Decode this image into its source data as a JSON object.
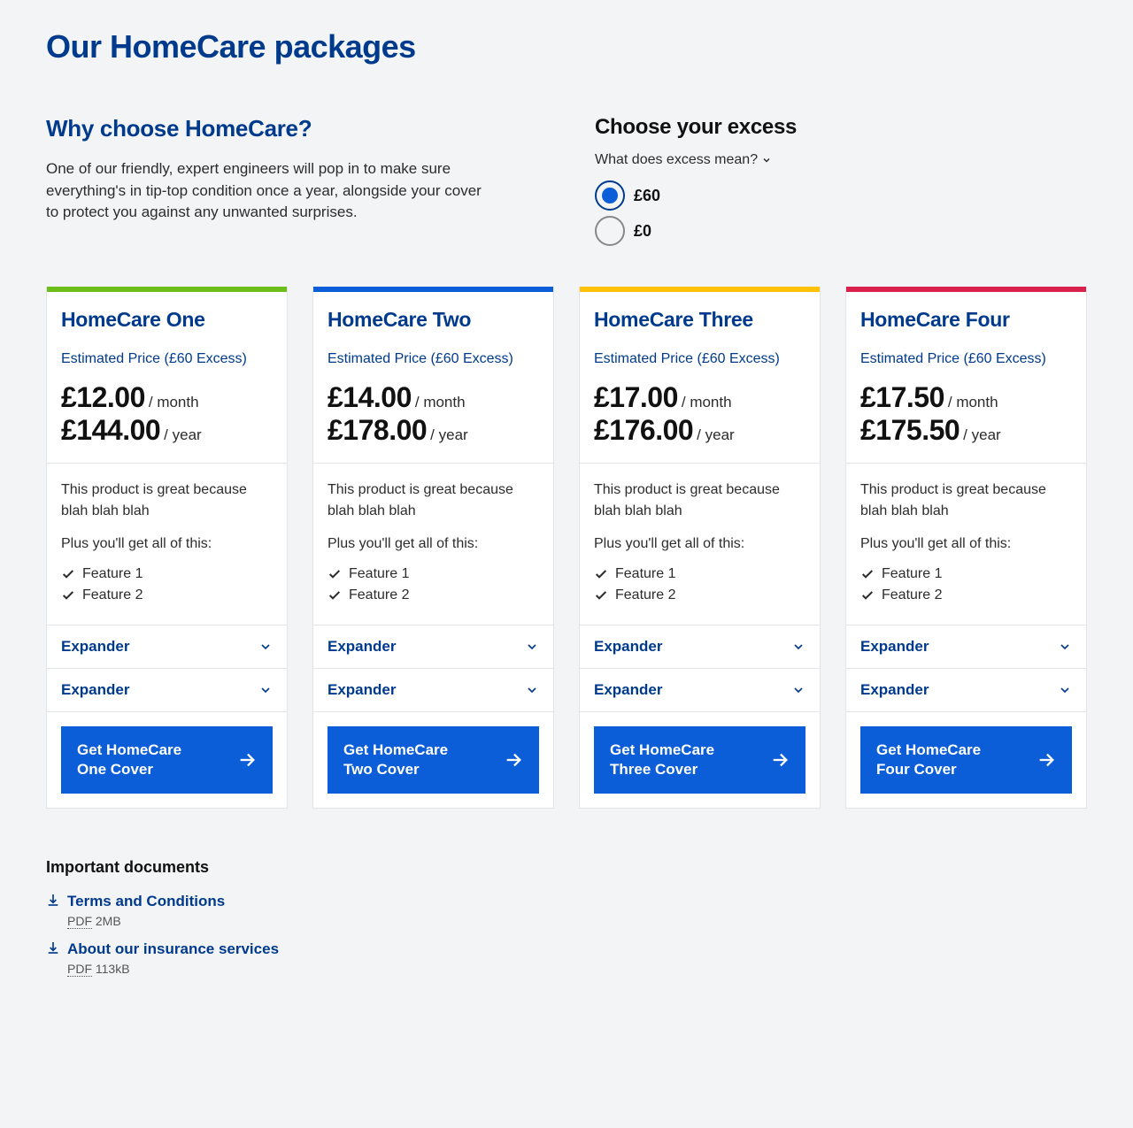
{
  "page_title": "Our HomeCare packages",
  "why": {
    "heading": "Why choose HomeCare?",
    "body": "One of our friendly, expert engineers will pop in to make sure everything's in tip-top condition once a year, alongside your cover to protect you against any unwanted surprises."
  },
  "excess": {
    "heading": "Choose your excess",
    "help_label": "What does excess mean?",
    "options": [
      {
        "label": "£60",
        "selected": true
      },
      {
        "label": "£0",
        "selected": false
      }
    ]
  },
  "est_label": "Estimated Price (£60 Excess)",
  "per_month": " / month",
  "per_year": " / year",
  "body_text": "This product is great because blah blah blah",
  "plus_text": "Plus you'll get all of this:",
  "feature1": "Feature 1",
  "feature2": "Feature 2",
  "expander_label": "Expander",
  "packages": [
    {
      "name": "HomeCare One",
      "accent": "accent-green",
      "monthly": "£12.00",
      "yearly": "£144.00",
      "cta": "Get HomeCare One Cover"
    },
    {
      "name": "HomeCare Two",
      "accent": "accent-blue",
      "monthly": "£14.00",
      "yearly": "£178.00",
      "cta": "Get HomeCare Two Cover"
    },
    {
      "name": "HomeCare Three",
      "accent": "accent-yellow",
      "monthly": "£17.00",
      "yearly": "£176.00",
      "cta": "Get HomeCare Three Cover"
    },
    {
      "name": "HomeCare Four",
      "accent": "accent-red",
      "monthly": "£17.50",
      "yearly": "£175.50",
      "cta": "Get HomeCare Four Cover"
    }
  ],
  "docs": {
    "heading": "Important documents",
    "items": [
      {
        "title": "Terms and Conditions",
        "type": "PDF",
        "size": "2MB"
      },
      {
        "title": "About our insurance services",
        "type": "PDF",
        "size": "113kB"
      }
    ]
  }
}
